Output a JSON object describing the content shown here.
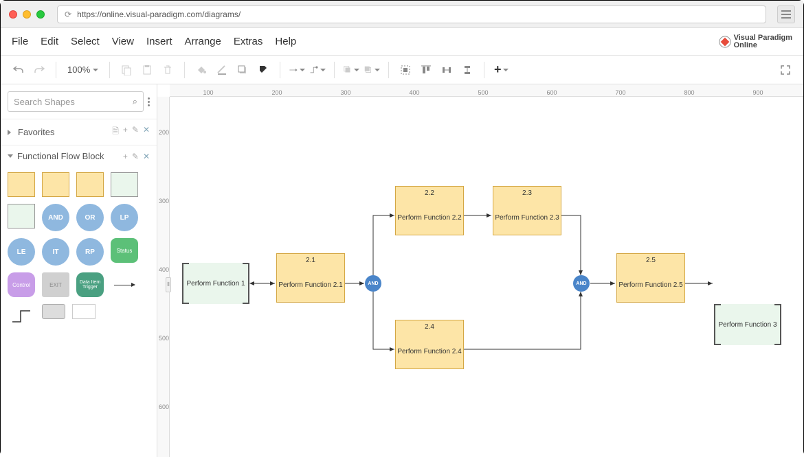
{
  "browser": {
    "url": "https://online.visual-paradigm.com/diagrams/"
  },
  "logo": {
    "brand": "Visual Paradigm",
    "sub": "Online"
  },
  "menu": [
    "File",
    "Edit",
    "Select",
    "View",
    "Insert",
    "Arrange",
    "Extras",
    "Help"
  ],
  "toolbar": {
    "zoom": "100%"
  },
  "sidebar": {
    "search_placeholder": "Search Shapes",
    "panels": {
      "favorites": "Favorites",
      "ffb": "Functional Flow Block"
    },
    "palette": {
      "and": "AND",
      "or": "OR",
      "lp": "LP",
      "le": "LE",
      "it": "IT",
      "rp": "RP",
      "status": "Status",
      "control": "Control",
      "exit": "EXIT",
      "trigger": "Data Item Trigger"
    }
  },
  "ruler": {
    "h": [
      "100",
      "200",
      "300",
      "400",
      "500",
      "600",
      "700",
      "800",
      "900"
    ],
    "v": [
      "200",
      "300",
      "400",
      "500",
      "600"
    ]
  },
  "diagram": {
    "ref1": {
      "label": "Perform Function 1"
    },
    "n21": {
      "id": "2.1",
      "label": "Perform Function 2.1"
    },
    "and1": {
      "label": "AND"
    },
    "n22": {
      "id": "2.2",
      "label": "Perform Function 2.2"
    },
    "n23": {
      "id": "2.3",
      "label": "Perform Function 2.3"
    },
    "n24": {
      "id": "2.4",
      "label": "Perform Function 2.4"
    },
    "and2": {
      "label": "AND"
    },
    "n25": {
      "id": "2.5",
      "label": "Perform Function 2.5"
    },
    "ref3": {
      "label": "Perform Function 3"
    }
  },
  "chart_data": {
    "type": "diagram",
    "diagram_type": "functional-flow-block",
    "nodes": [
      {
        "id": "ref1",
        "kind": "reference",
        "label": "Perform Function 1"
      },
      {
        "id": "2.1",
        "kind": "function",
        "label": "Perform Function 2.1"
      },
      {
        "id": "and1",
        "kind": "gate",
        "label": "AND"
      },
      {
        "id": "2.2",
        "kind": "function",
        "label": "Perform Function 2.2"
      },
      {
        "id": "2.3",
        "kind": "function",
        "label": "Perform Function 2.3"
      },
      {
        "id": "2.4",
        "kind": "function",
        "label": "Perform Function 2.4"
      },
      {
        "id": "and2",
        "kind": "gate",
        "label": "AND"
      },
      {
        "id": "2.5",
        "kind": "function",
        "label": "Perform Function 2.5"
      },
      {
        "id": "ref3",
        "kind": "reference",
        "label": "Perform Function 3"
      }
    ],
    "edges": [
      {
        "from": "ref1",
        "to": "2.1"
      },
      {
        "from": "2.1",
        "to": "and1"
      },
      {
        "from": "and1",
        "to": "2.2"
      },
      {
        "from": "and1",
        "to": "2.4"
      },
      {
        "from": "2.2",
        "to": "2.3"
      },
      {
        "from": "2.3",
        "to": "and2"
      },
      {
        "from": "2.4",
        "to": "and2"
      },
      {
        "from": "and2",
        "to": "2.5"
      },
      {
        "from": "2.5",
        "to": "ref3"
      }
    ]
  }
}
